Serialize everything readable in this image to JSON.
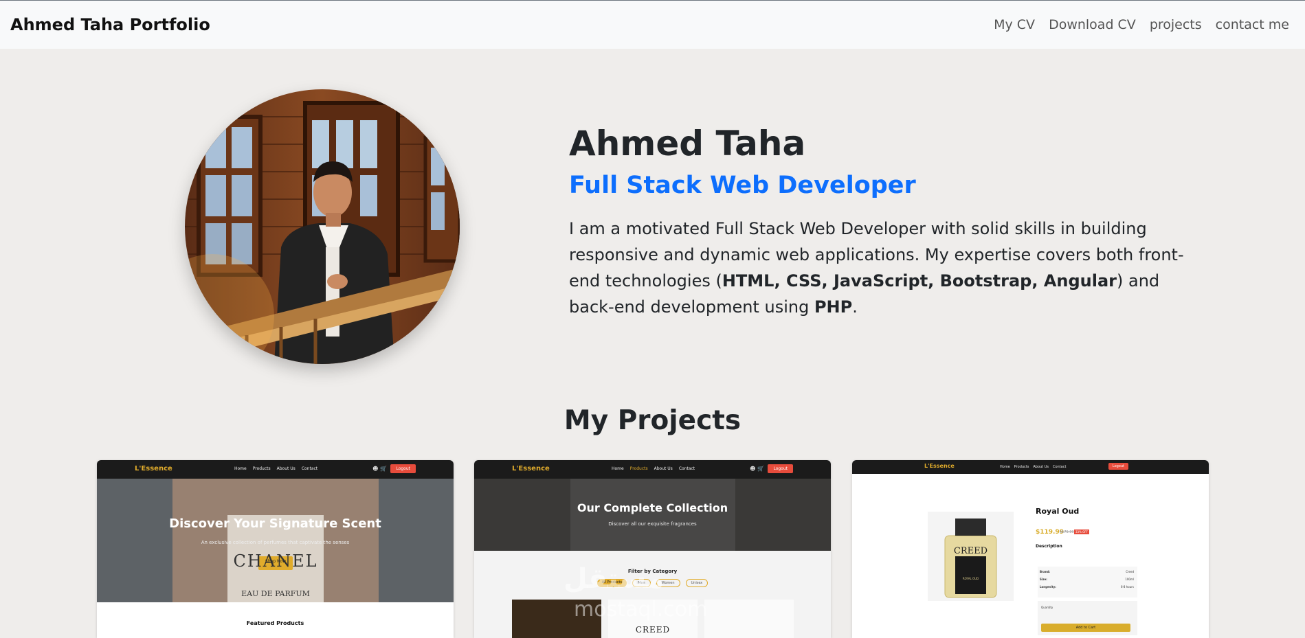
{
  "navbar": {
    "brand": "Ahmed Taha Portfolio",
    "links": [
      "My CV",
      "Download CV",
      "projects",
      "contact me"
    ]
  },
  "hero": {
    "name": "Ahmed Taha",
    "title": "Full Stack Web Developer",
    "bio_part1": "I am a motivated Full Stack Web Developer with solid skills in building responsive and dynamic web applications. My expertise covers both front-end technologies (",
    "bio_bold1": "HTML, CSS, JavaScript, Bootstrap, Angular",
    "bio_part2": ") and back-end development using ",
    "bio_bold2": "PHP",
    "bio_part3": "."
  },
  "projects": {
    "heading": "My Projects",
    "cards": [
      {
        "brand": "L'Essence",
        "nav": [
          "Home",
          "Products",
          "About Us",
          "Contact"
        ],
        "logout": "Logout",
        "hero_title": "Discover Your Signature Scent",
        "hero_sub": "An exclusive collection of perfumes that captivate the senses",
        "cta": "Shop Now",
        "bottle_label": "CHANEL",
        "bottle_sub": "EAU DE PARFUM",
        "section_title": "Featured Products"
      },
      {
        "brand": "L'Essence",
        "nav": [
          "Home",
          "Products",
          "About Us",
          "Contact"
        ],
        "logout": "Logout",
        "hero_title": "Our Complete Collection",
        "hero_sub": "Discover all our exquisite fragrances",
        "filter_title": "Filter by Category",
        "filters": [
          "All Products",
          "Men",
          "Women",
          "Unisex"
        ],
        "product_label": "CREED"
      },
      {
        "brand": "L'Essence",
        "nav": [
          "Home",
          "Products",
          "About Us",
          "Contact"
        ],
        "logout": "Logout",
        "product_name": "Royal Oud",
        "price": "$119.99",
        "old_price": "$179.99",
        "discount": "33% OFF",
        "description_title": "Description",
        "specs": [
          [
            "Brand:",
            "Creed"
          ],
          [
            "Size:",
            "100ml"
          ],
          [
            "Longevity:",
            "6-8 hours"
          ]
        ],
        "quantity_label": "Quantity",
        "add_to_cart": "Add to Cart",
        "bottle_label": "CREED",
        "bottle_sub": "ROYAL OUD"
      }
    ]
  },
  "watermark": {
    "arabic": "مستقل",
    "latin": "mostaql.com"
  },
  "colors": {
    "accent": "#0d6efd",
    "gold": "#e1ac2c",
    "logout": "#e74c3c",
    "background": "#efedeb"
  }
}
